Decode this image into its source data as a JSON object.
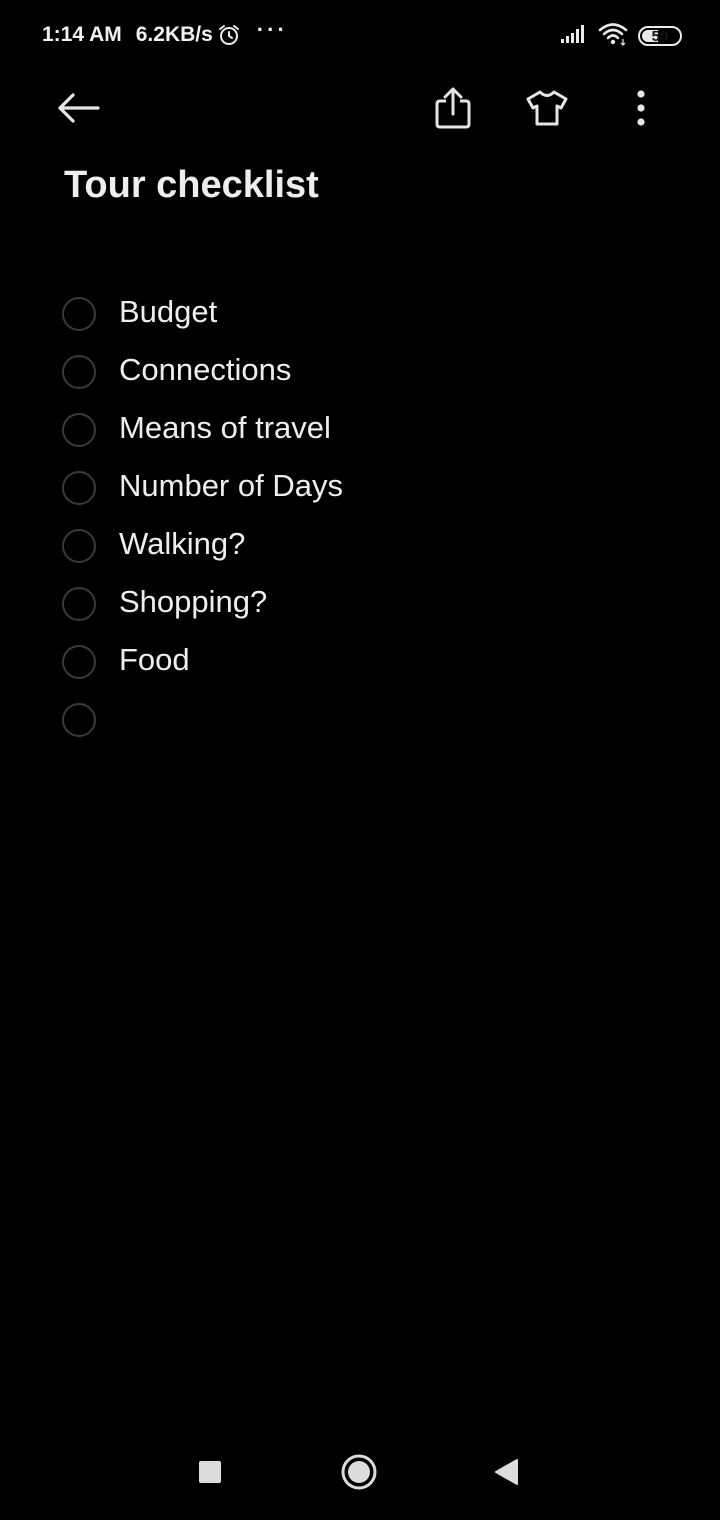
{
  "status_bar": {
    "time": "1:14 AM",
    "network_speed": "6.2KB/s",
    "more": "···",
    "battery_level": "50",
    "battery_fraction": 0.5,
    "icons": [
      "alarm-icon",
      "signal-icon",
      "wifi-icon",
      "battery-icon"
    ]
  },
  "app_bar": {
    "icons": [
      "back-arrow-icon",
      "share-icon",
      "shirt-icon",
      "more-vert-icon"
    ]
  },
  "note": {
    "title": "Tour checklist",
    "items": [
      {
        "label": "Budget",
        "checked": false
      },
      {
        "label": "Connections",
        "checked": false
      },
      {
        "label": "Means of travel",
        "checked": false
      },
      {
        "label": "Number of Days",
        "checked": false
      },
      {
        "label": "Walking?",
        "checked": false
      },
      {
        "label": "Shopping?",
        "checked": false
      },
      {
        "label": "Food",
        "checked": false
      },
      {
        "label": "",
        "checked": false
      }
    ]
  },
  "nav_bar": {
    "icons": [
      "recents-square-icon",
      "home-circle-icon",
      "back-triangle-icon"
    ]
  },
  "colors": {
    "background": "#000000",
    "text": "#eeeeee",
    "checkbox_border": "#3a3a3a",
    "icon": "#e6e6e6"
  }
}
